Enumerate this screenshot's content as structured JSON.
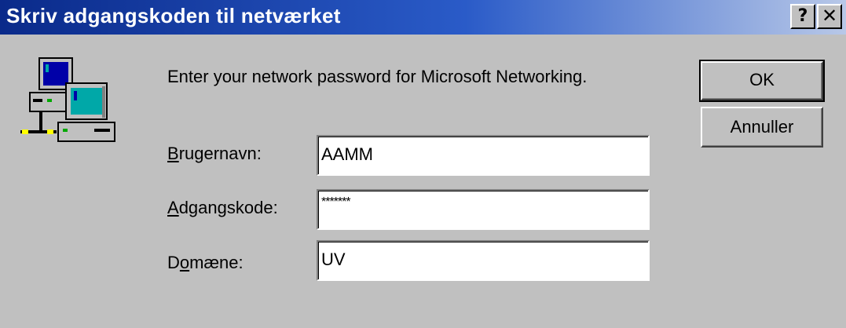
{
  "window": {
    "title": "Skriv adgangskoden til netværket",
    "help_glyph": "?",
    "close_glyph": "✕"
  },
  "message": "Enter your network password for Microsoft Networking.",
  "fields": {
    "username": {
      "label_accel": "B",
      "label_rest": "rugernavn:",
      "value": "AAMM"
    },
    "password": {
      "label_accel": "A",
      "label_rest": "dgangskode:",
      "value": "*******"
    },
    "domain": {
      "label_pre": "D",
      "label_accel": "o",
      "label_rest": "mæne:",
      "value": "UV"
    }
  },
  "buttons": {
    "ok": "OK",
    "cancel": "Annuller"
  },
  "icons": {
    "network": "network-computers-icon",
    "help": "help-icon",
    "close": "close-icon"
  },
  "colors": {
    "title_start": "#0a2a8a",
    "title_end": "#b8c8e8",
    "face": "#c0c0c0"
  }
}
